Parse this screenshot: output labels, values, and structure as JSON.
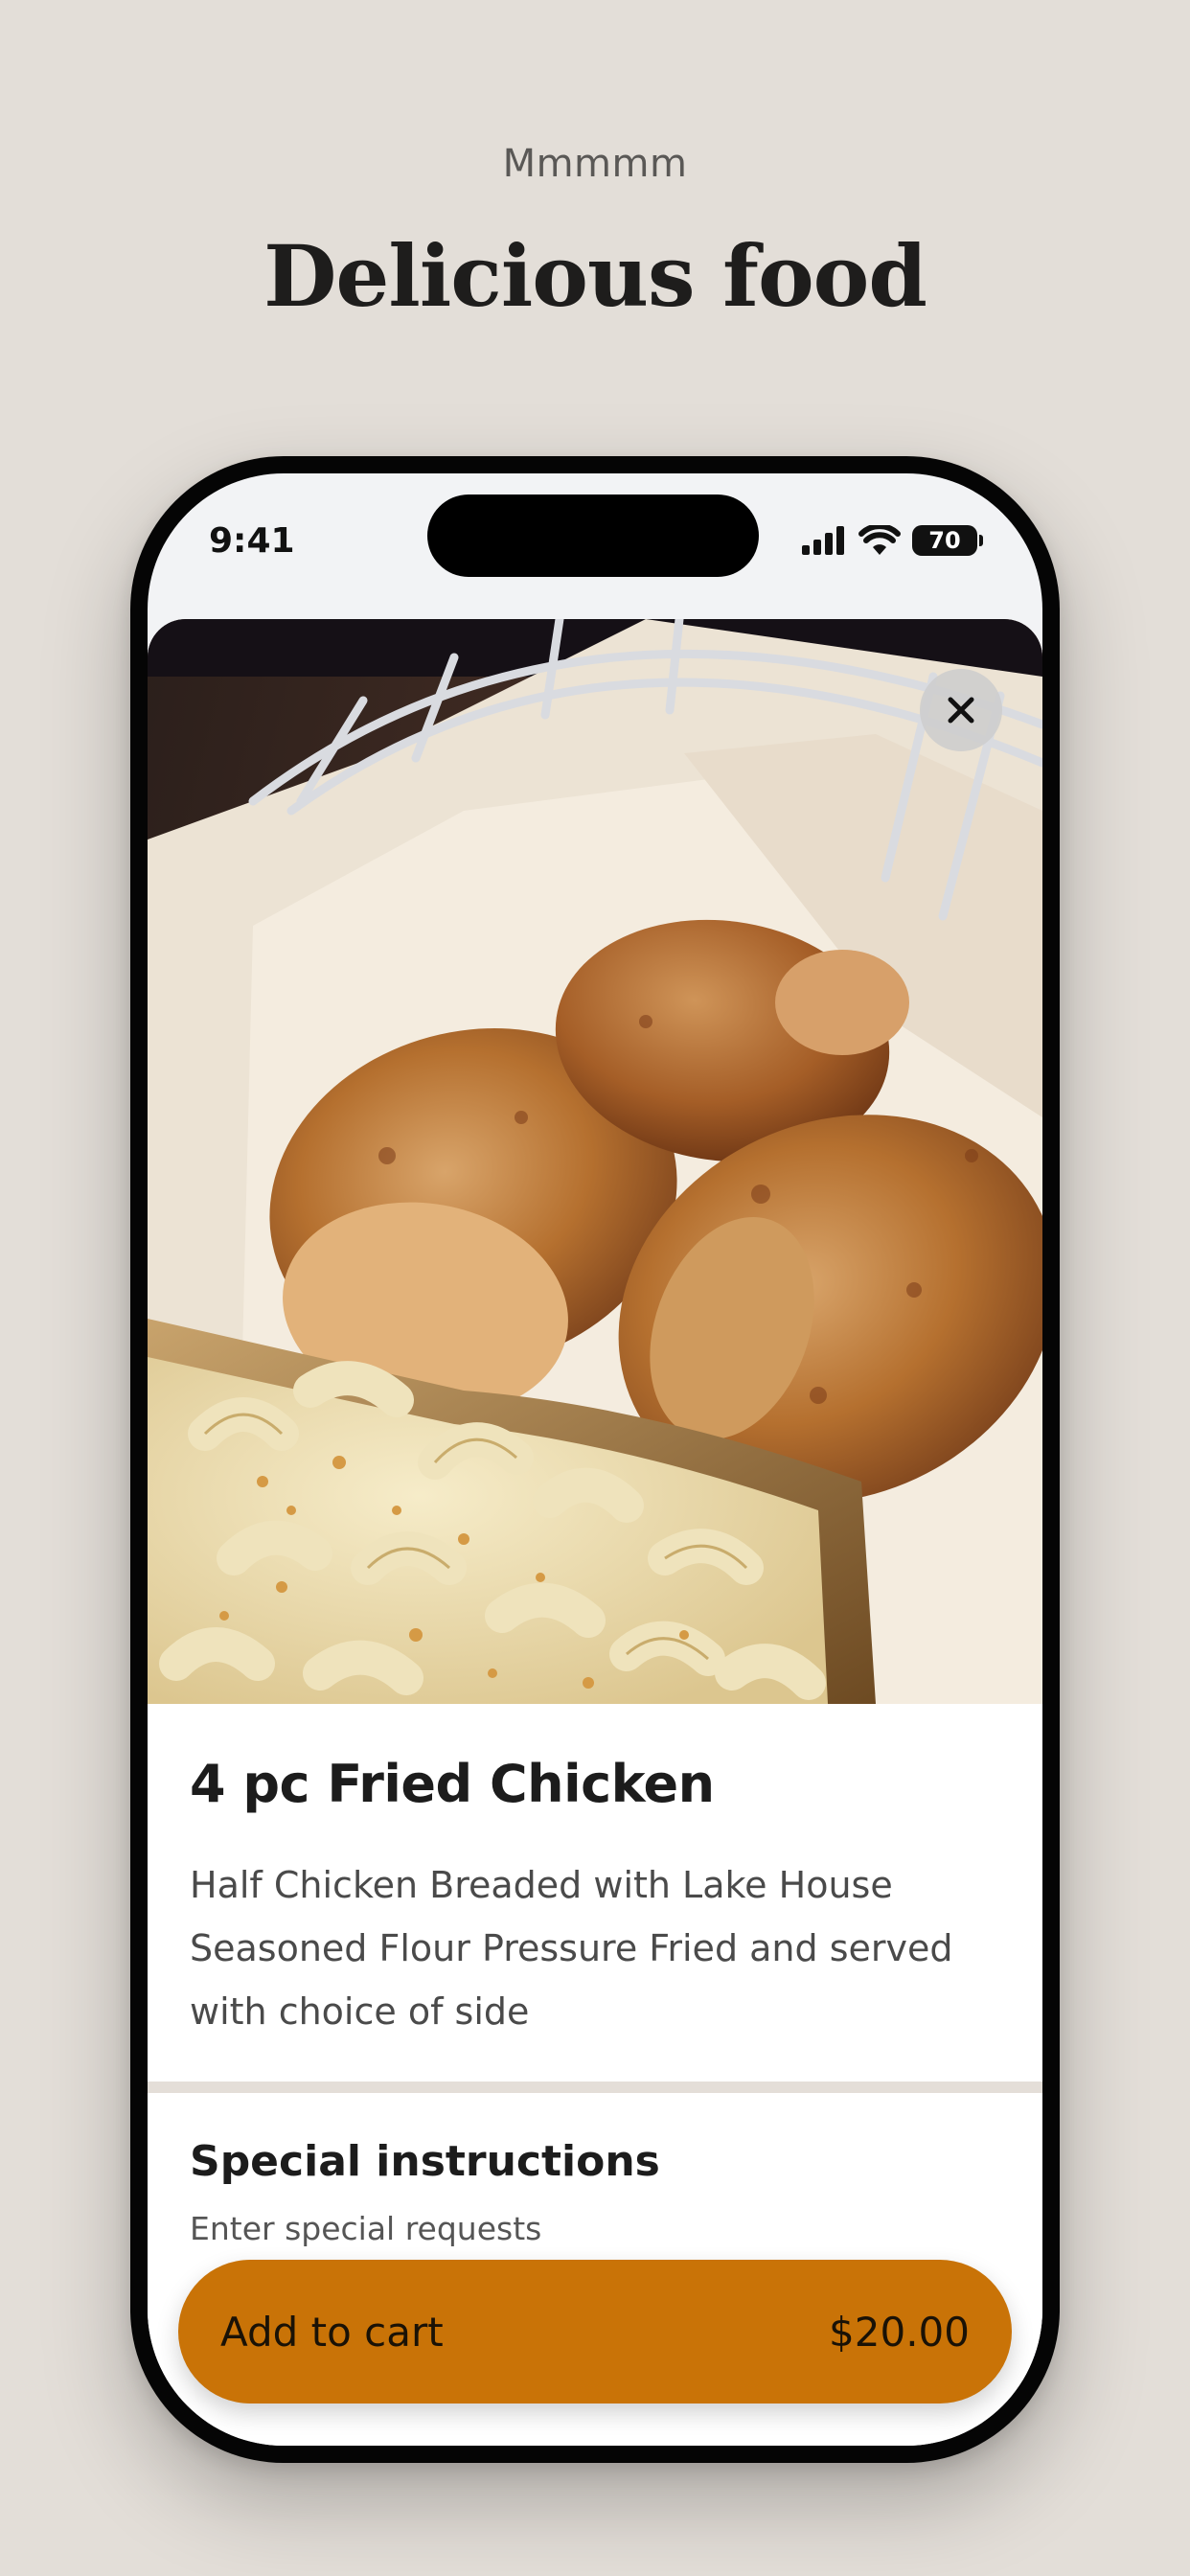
{
  "promo": {
    "eyebrow": "Mmmmm",
    "headline": "Delicious food"
  },
  "status_bar": {
    "time": "9:41",
    "battery": "70",
    "icons": [
      "signal-icon",
      "wifi-icon",
      "battery-icon"
    ]
  },
  "item": {
    "title": "4 pc Fried Chicken",
    "description": "Half Chicken Breaded with Lake House Seasoned Flour Pressure Fried and served with choice of side",
    "photo": "fried-chicken-with-mac-and-cheese-photo"
  },
  "instructions": {
    "title": "Special instructions",
    "placeholder": "Enter special requests"
  },
  "cart": {
    "label": "Add to cart",
    "price": "$20.00",
    "color": "#c97307"
  },
  "colors": {
    "background": "#e3ded8",
    "text": "#1c1c1c"
  }
}
